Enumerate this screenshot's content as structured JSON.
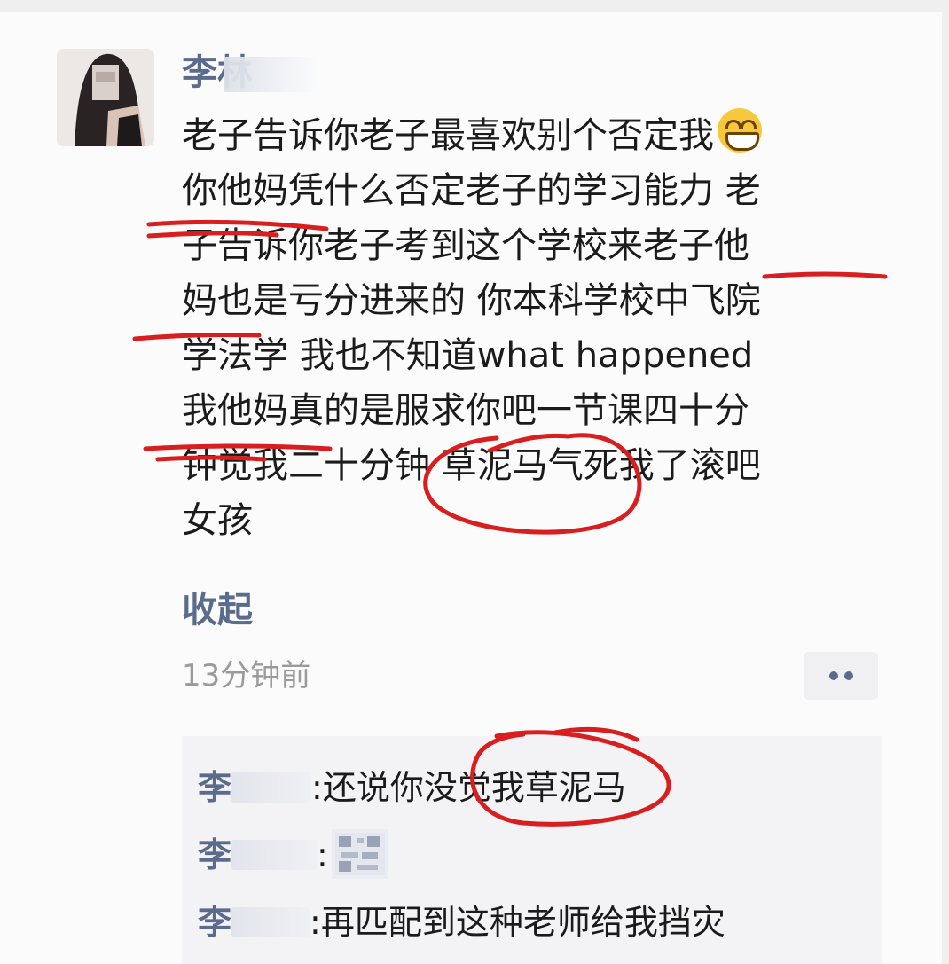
{
  "post": {
    "author_name": "李",
    "author_name_visible_part": "林",
    "lines": [
      "老子告诉你老子最喜欢别个否定我",
      "你他妈凭什么否定老子的学习能力 老",
      "子告诉你老子考到这个学校来老子他",
      "妈也是亏分进来的 你本科学校中飞院",
      "学法学 我也不知道what happened",
      "我他妈真的是服求你吧一节课四十分",
      "钟觉我二十分钟 草泥马气死我了滚吧",
      "女孩"
    ],
    "emoji_name": "grinning-face-emoji",
    "collapse_label": "收起",
    "time_label": "13分钟前"
  },
  "comments": [
    {
      "name": "李",
      "colon": ":",
      "text": "还说你没觉我草泥马"
    },
    {
      "name": "李",
      "colon": ":",
      "text": ""
    },
    {
      "name": "李",
      "colon": ":",
      "text": "再匹配到这种老师给我挡灾"
    }
  ],
  "colors": {
    "name_link": "#5b6b8c",
    "body_text": "#1b1b1b",
    "time_text": "#9a9a9a",
    "comment_bg": "#f3f3f5",
    "annotation_red": "#d81e1e"
  }
}
